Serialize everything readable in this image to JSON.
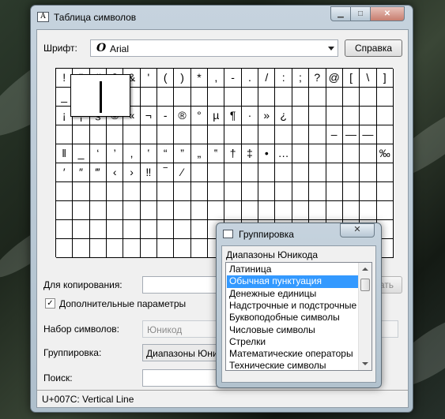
{
  "window": {
    "title": "Таблица символов",
    "title_icon_glyph": "A",
    "buttons": {
      "minimize": "▁",
      "maximize": "□",
      "close": "✕"
    }
  },
  "font_row": {
    "label": "Шрифт:",
    "icon_glyph": "O",
    "value": "Arial",
    "help_button": "Справка"
  },
  "grid": {
    "rows": [
      [
        "!",
        "\"",
        "#",
        "$",
        "&",
        "'",
        "(",
        ")",
        "*",
        ",",
        "-",
        ".",
        "/",
        ":",
        ";",
        "?",
        "@",
        "[",
        "\\",
        "]"
      ],
      [
        "_",
        "",
        "",
        "",
        "",
        "",
        "",
        "",
        "",
        "",
        "",
        "",
        "",
        "",
        "",
        "",
        "",
        "",
        "",
        ""
      ],
      [
        "¡",
        "¦",
        "§",
        "©",
        "«",
        "¬",
        "-",
        "®",
        "°",
        "µ",
        "¶",
        "·",
        "»",
        "¿",
        "",
        "",
        "",
        "",
        "",
        ""
      ],
      [
        "",
        "",
        "",
        "",
        "",
        "",
        "",
        "",
        "",
        "",
        "",
        "",
        "",
        "",
        "",
        "",
        "–",
        "—",
        "―",
        ""
      ],
      [
        "‖",
        "_",
        "‘",
        "’",
        "‚",
        "‛",
        "“",
        "”",
        "„",
        "‟",
        "†",
        "‡",
        "•",
        "…",
        "",
        "",
        "",
        "",
        "",
        "‰"
      ],
      [
        "′",
        "″",
        "‴",
        "‹",
        "›",
        "‼",
        "‾",
        "⁄",
        "",
        "",
        "",
        "",
        "",
        "",
        "",
        "",
        "",
        "",
        "",
        ""
      ],
      [
        "",
        "",
        "",
        "",
        "",
        "",
        "",
        "",
        "",
        "",
        "",
        "",
        "",
        "",
        "",
        "",
        "",
        "",
        "",
        ""
      ],
      [
        "",
        "",
        "",
        "",
        "",
        "",
        "",
        "",
        "",
        "",
        "",
        "",
        "",
        "",
        "",
        "",
        "",
        "",
        "",
        ""
      ],
      [
        "",
        "",
        "",
        "",
        "",
        "",
        "",
        "",
        "",
        "",
        "",
        "",
        "",
        "",
        "",
        "",
        "",
        "",
        "",
        ""
      ],
      [
        "",
        "",
        "",
        "",
        "",
        "",
        "",
        "",
        "",
        "",
        "",
        "",
        "",
        "",
        "",
        "",
        "",
        "",
        "",
        ""
      ]
    ],
    "zoomed_char": "|"
  },
  "copy_row": {
    "label": "Для копирования:",
    "value": "",
    "copy_button_partial": "ать"
  },
  "advanced": {
    "label": "Дополнительные параметры",
    "checked": true,
    "check_glyph": "✓"
  },
  "charset": {
    "label": "Набор символов:",
    "value": "Юникод"
  },
  "grouping": {
    "label": "Группировка:",
    "value": "Диапазоны Юникода"
  },
  "search": {
    "label": "Поиск:",
    "value": ""
  },
  "status": "U+007C: Vertical Line",
  "popup": {
    "title": "Группировка",
    "close": "✕",
    "header": "Диапазоны Юникода",
    "items": [
      "Латиница",
      "Обычная пунктуация",
      "Денежные единицы",
      "Надстрочные и подстрочные",
      "Буквоподобные символы",
      "Числовые символы",
      "Стрелки",
      "Математические операторы",
      "Технические символы"
    ],
    "selected_index": 1
  }
}
